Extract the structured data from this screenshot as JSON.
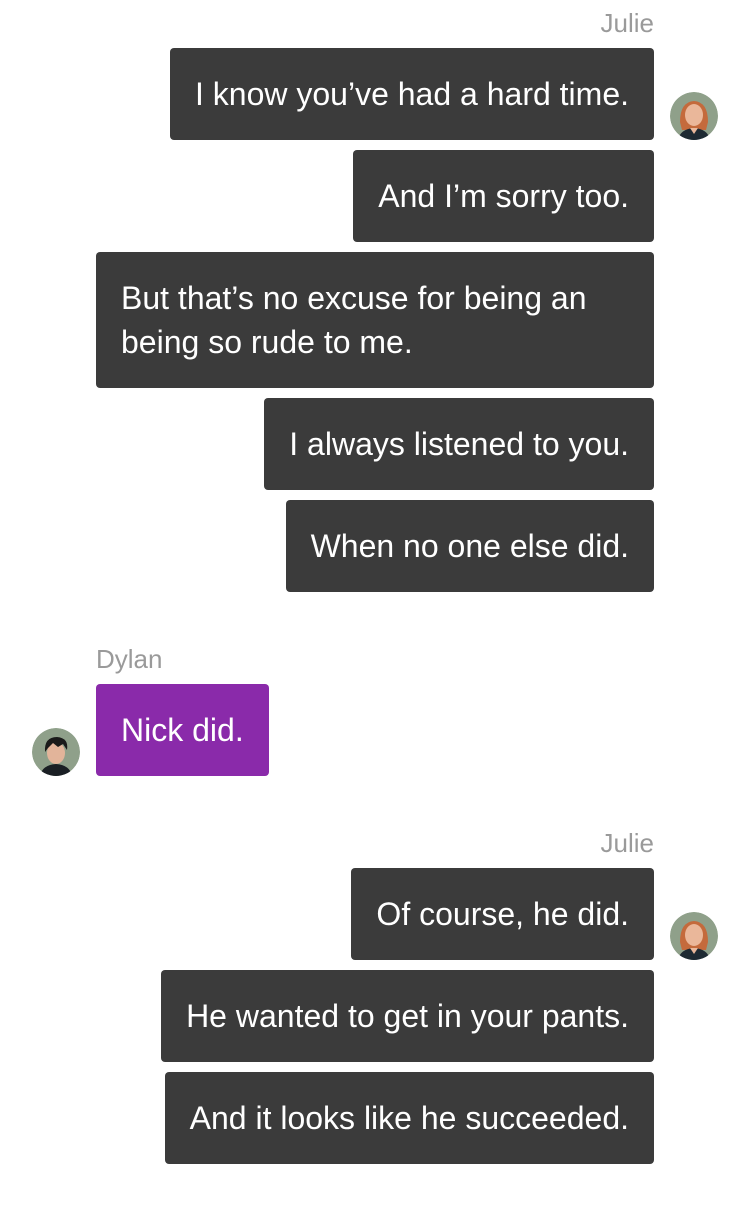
{
  "groups": [
    {
      "sender": "Julie",
      "messages": [
        "I know you’ve had a hard time.",
        "And I’m sorry too.",
        "But that’s no excuse for being an being so rude to me.",
        "I always listened to you.",
        "When no one else did."
      ]
    },
    {
      "sender": "Dylan",
      "messages": [
        "Nick did."
      ]
    },
    {
      "sender": "Julie",
      "messages": [
        "Of course, he did.",
        "He wanted to get in your pants.",
        "And it looks like he succeeded."
      ]
    }
  ],
  "colors": {
    "julie_bubble": "#3b3b3b",
    "dylan_bubble": "#8a2aaa",
    "sender_label": "#9a9a9a",
    "background": "#ffffff"
  },
  "icons": {
    "julie_avatar": "avatar-julie-icon",
    "dylan_avatar": "avatar-dylan-icon"
  }
}
